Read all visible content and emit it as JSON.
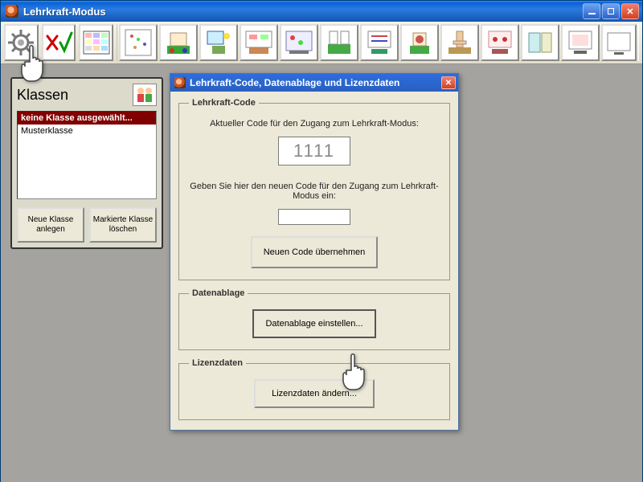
{
  "window": {
    "title": "Lehrkraft-Modus"
  },
  "klassen": {
    "title": "Klassen",
    "selected": "keine Klasse ausgewählt...",
    "items": [
      "Musterklasse"
    ],
    "new_btn": "Neue Klasse anlegen",
    "del_btn": "Markierte Klasse löschen"
  },
  "dialog": {
    "title": "Lehrkraft-Code, Datenablage und Lizenzdaten",
    "code": {
      "legend": "Lehrkraft-Code",
      "current_label": "Aktueller Code für den Zugang zum Lehrkraft-Modus:",
      "current_value": "1111",
      "new_label": "Geben Sie hier den neuen Code für den Zugang zum Lehrkraft-Modus ein:",
      "new_value": "",
      "apply_btn": "Neuen Code übernehmen"
    },
    "storage": {
      "legend": "Datenablage",
      "btn": "Datenablage einstellen..."
    },
    "license": {
      "legend": "Lizenzdaten",
      "btn": "Lizenzdaten ändern..."
    }
  }
}
